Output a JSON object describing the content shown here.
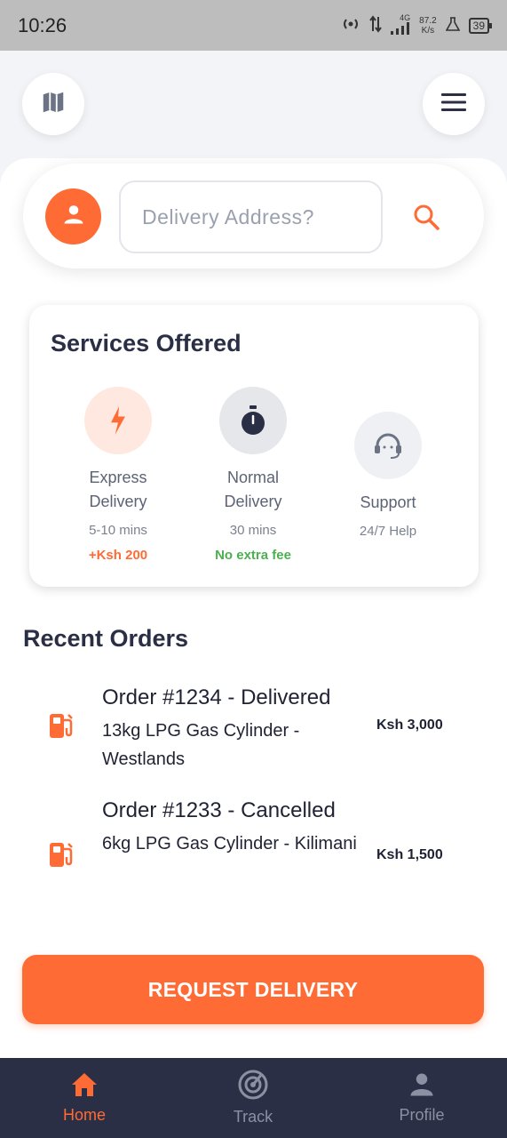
{
  "status_bar": {
    "time": "10:26",
    "net_speed_value": "87.2",
    "net_speed_unit": "K/s",
    "network": "4G",
    "battery": "39"
  },
  "search": {
    "placeholder": "Delivery Address?"
  },
  "services": {
    "title": "Services Offered",
    "items": [
      {
        "name_line1": "Express",
        "name_line2": "Delivery",
        "sub": "5-10 mins",
        "extra": "+Ksh 200",
        "icon": "bolt-icon",
        "accent": "#ff6b35"
      },
      {
        "name_line1": "Normal",
        "name_line2": "Delivery",
        "sub": "30 mins",
        "extra": "No extra fee",
        "icon": "stopwatch-icon",
        "accent": "#4caf50"
      },
      {
        "name_line1": "Support",
        "sub": "24/7 Help",
        "icon": "headset-icon"
      }
    ]
  },
  "recent_orders": {
    "title": "Recent Orders",
    "orders": [
      {
        "title": "Order #1234 - Delivered",
        "item": "13kg LPG Gas Cylinder - Westlands",
        "price": "Ksh 3,000",
        "icon": "gas-pump-icon"
      },
      {
        "title": "Order #1233 - Cancelled",
        "item": "6kg LPG Gas Cylinder - Kilimani",
        "price": "Ksh 1,500",
        "icon": "gas-pump-icon"
      }
    ]
  },
  "request_button": {
    "label": "REQUEST DELIVERY"
  },
  "bottom_nav": {
    "items": [
      {
        "label": "Home",
        "icon": "home-icon",
        "active": true
      },
      {
        "label": "Track",
        "icon": "track-icon",
        "active": false
      },
      {
        "label": "Profile",
        "icon": "person-icon",
        "active": false
      }
    ]
  },
  "colors": {
    "accent": "#ff6b35",
    "nav_bg": "#2b2f45",
    "success": "#4caf50"
  }
}
